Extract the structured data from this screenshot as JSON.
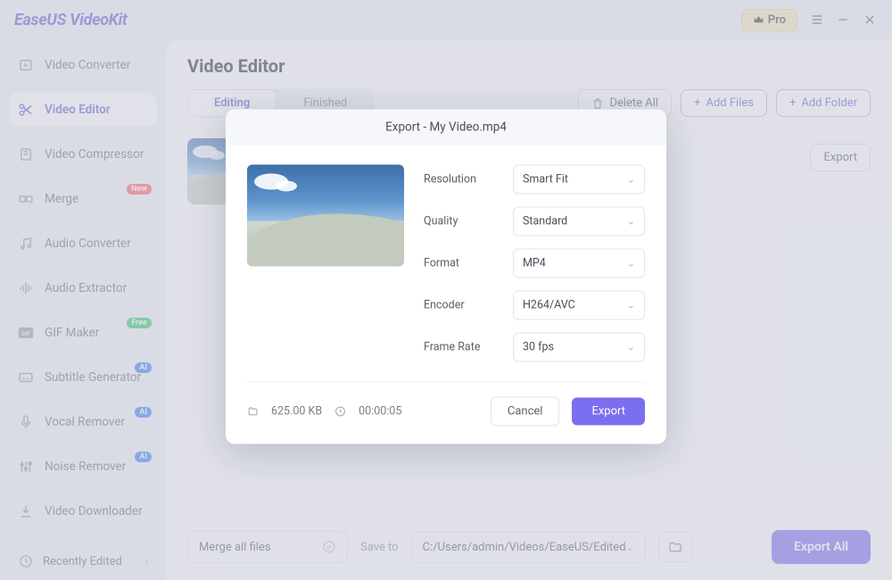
{
  "app": {
    "name": "EaseUS VideoKit",
    "pro_label": "Pro"
  },
  "sidebar": {
    "items": [
      {
        "label": "Video Converter"
      },
      {
        "label": "Video Editor"
      },
      {
        "label": "Video Compressor"
      },
      {
        "label": "Merge",
        "badge": "New"
      },
      {
        "label": "Audio Converter"
      },
      {
        "label": "Audio Extractor"
      },
      {
        "label": "GIF Maker",
        "badge": "Free"
      },
      {
        "label": "Subtitle Generator",
        "badge": "AI"
      },
      {
        "label": "Vocal Remover",
        "badge": "AI"
      },
      {
        "label": "Noise Remover",
        "badge": "AI"
      },
      {
        "label": "Video Downloader"
      }
    ],
    "bottom": "Recently Edited"
  },
  "page": {
    "title": "Video Editor",
    "tabs": {
      "editing": "Editing",
      "finished": "Finished"
    },
    "delete_all": "Delete All",
    "add_files": "Add Files",
    "add_folder": "Add Folder",
    "export": "Export",
    "export_all": "Export All",
    "merge_all": "Merge all files",
    "save_to_label": "Save to",
    "save_path": "C:/Users/admin/Videos/EaseUS/Edited"
  },
  "file": {
    "name": "My Video.mp4"
  },
  "modal": {
    "title": "Export - My Video.mp4",
    "labels": {
      "resolution": "Resolution",
      "quality": "Quality",
      "format": "Format",
      "encoder": "Encoder",
      "frame_rate": "Frame Rate"
    },
    "values": {
      "resolution": "Smart Fit",
      "quality": "Standard",
      "format": "MP4",
      "encoder": "H264/AVC",
      "frame_rate": "30 fps"
    },
    "size": "625.00 KB",
    "duration": "00:00:05",
    "cancel": "Cancel",
    "export": "Export"
  }
}
